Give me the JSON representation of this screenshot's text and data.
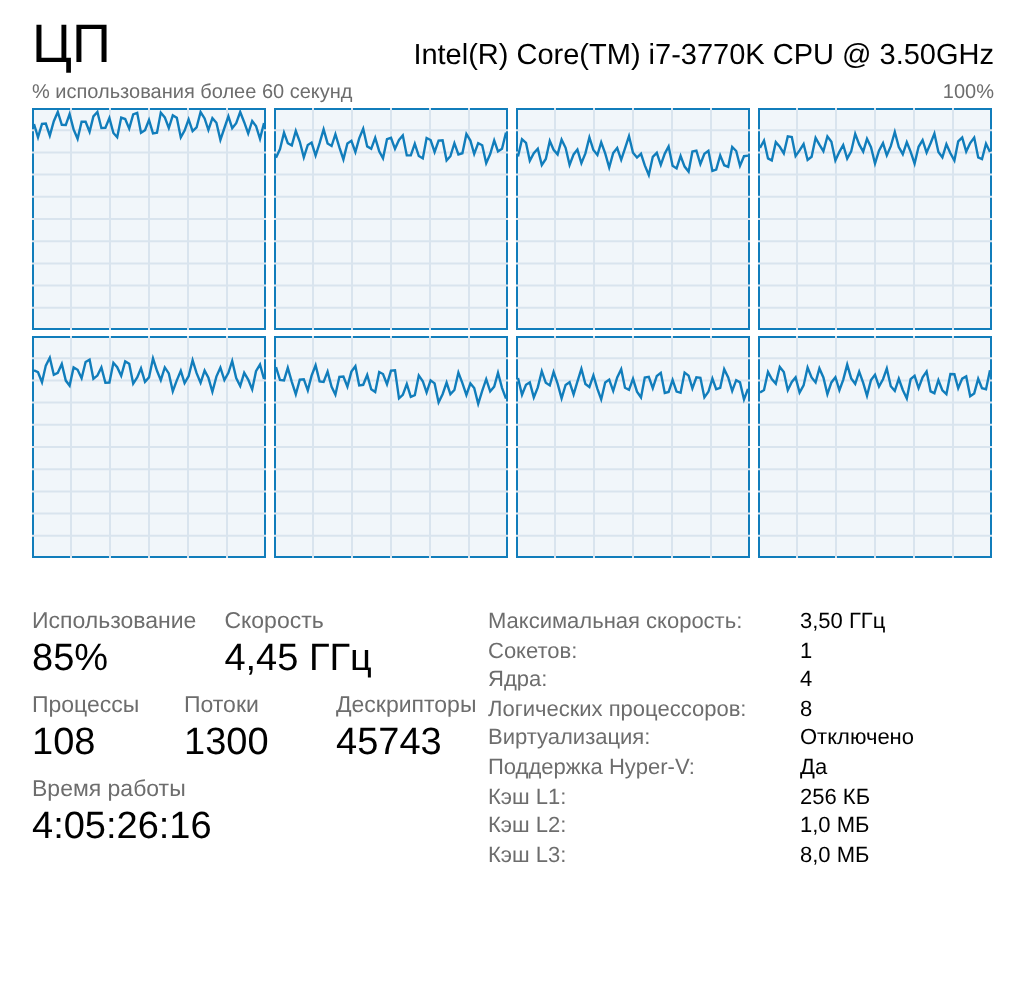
{
  "title": "ЦП",
  "processor": "Intel(R) Core(TM) i7-3770K CPU @ 3.50GHz",
  "graph_caption": "% использования более 60 секунд",
  "graph_max": "100%",
  "graphs": [
    {
      "kind": "cpu"
    },
    {
      "kind": "cpu"
    },
    {
      "kind": "cpu"
    },
    {
      "kind": "cpu"
    },
    {
      "kind": "cpu"
    },
    {
      "kind": "cpu"
    },
    {
      "kind": "cpu"
    },
    {
      "kind": "cpu"
    }
  ],
  "stat_rows": [
    [
      {
        "label": "Использование",
        "value": "85%"
      },
      {
        "label": "Скорость",
        "value": "4,45 ГГц"
      }
    ],
    [
      {
        "label": "Процессы",
        "value": "108"
      },
      {
        "label": "Потоки",
        "value": "1300"
      },
      {
        "label": "Дескрипторы",
        "value": "45743"
      }
    ],
    [
      {
        "label": "Время работы",
        "value": "4:05:26:16"
      }
    ]
  ],
  "details": [
    {
      "label": "Максимальная скорость:",
      "value": "3,50 ГГц"
    },
    {
      "label": "Сокетов:",
      "value": "1"
    },
    {
      "label": "Ядра:",
      "value": "4"
    },
    {
      "label": "Логических процессоров:",
      "value": "8"
    },
    {
      "label": "Виртуализация:",
      "value": "Отключено"
    },
    {
      "label": "Поддержка Hyper-V:",
      "value": "Да"
    },
    {
      "label": "Кэш L1:",
      "value": "256 КБ"
    },
    {
      "label": "Кэш L2:",
      "value": "1,0 МБ"
    },
    {
      "label": "Кэш L3:",
      "value": "8,0 МБ"
    }
  ]
}
